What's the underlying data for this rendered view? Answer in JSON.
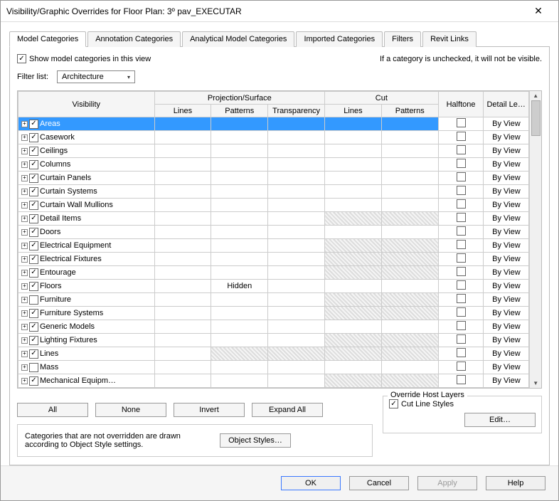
{
  "window": {
    "title": "Visibility/Graphic Overrides for Floor Plan: 3º pav_EXECUTAR"
  },
  "tabs": [
    {
      "label": "Model Categories",
      "active": true
    },
    {
      "label": "Annotation Categories",
      "active": false
    },
    {
      "label": "Analytical Model Categories",
      "active": false
    },
    {
      "label": "Imported Categories",
      "active": false
    },
    {
      "label": "Filters",
      "active": false
    },
    {
      "label": "Revit Links",
      "active": false
    }
  ],
  "showModelLabel": "Show model categories in this view",
  "uncheckedNote": "If a category is unchecked, it will not be visible.",
  "filterLabel": "Filter list:",
  "filterValue": "Architecture",
  "headers": {
    "visibility": "Visibility",
    "projSurf": "Projection/Surface",
    "cut": "Cut",
    "halftone": "Halftone",
    "detail": "Detail Level",
    "lines": "Lines",
    "patterns": "Patterns",
    "transparency": "Transparency"
  },
  "rows": [
    {
      "name": "Areas",
      "checked": true,
      "selected": true,
      "cutShaded": false,
      "pattern": ""
    },
    {
      "name": "Casework",
      "checked": true,
      "cutShaded": false
    },
    {
      "name": "Ceilings",
      "checked": true,
      "cutShaded": false
    },
    {
      "name": "Columns",
      "checked": true,
      "cutShaded": false
    },
    {
      "name": "Curtain Panels",
      "checked": true,
      "cutShaded": false
    },
    {
      "name": "Curtain Systems",
      "checked": true,
      "cutShaded": false
    },
    {
      "name": "Curtain Wall Mullions",
      "checked": true,
      "cutShaded": false
    },
    {
      "name": "Detail Items",
      "checked": true,
      "cutShaded": true
    },
    {
      "name": "Doors",
      "checked": true,
      "cutShaded": false
    },
    {
      "name": "Electrical Equipment",
      "checked": true,
      "cutShaded": true
    },
    {
      "name": "Electrical Fixtures",
      "checked": true,
      "cutShaded": true
    },
    {
      "name": "Entourage",
      "checked": true,
      "cutShaded": true
    },
    {
      "name": "Floors",
      "checked": true,
      "cutShaded": false,
      "pattern": "Hidden"
    },
    {
      "name": "Furniture",
      "checked": false,
      "cutShaded": true
    },
    {
      "name": "Furniture Systems",
      "checked": true,
      "cutShaded": true
    },
    {
      "name": "Generic Models",
      "checked": true,
      "cutShaded": false
    },
    {
      "name": "Lighting Fixtures",
      "checked": true,
      "cutShaded": true
    },
    {
      "name": "Lines",
      "checked": true,
      "cutShaded": true,
      "projShaded": true
    },
    {
      "name": "Mass",
      "checked": false,
      "cutShaded": false
    },
    {
      "name": "Mechanical Equipm…",
      "checked": true,
      "cutShaded": true
    }
  ],
  "detailDefault": "By View",
  "buttons": {
    "all": "All",
    "none": "None",
    "invert": "Invert",
    "expand": "Expand All",
    "objectStyles": "Object Styles…",
    "edit": "Edit…"
  },
  "noteText": "Categories that are not overridden are drawn according to Object Style settings.",
  "overrideTitle": "Override Host Layers",
  "cutLineStyles": "Cut Line Styles",
  "dialog": {
    "ok": "OK",
    "cancel": "Cancel",
    "apply": "Apply",
    "help": "Help"
  }
}
